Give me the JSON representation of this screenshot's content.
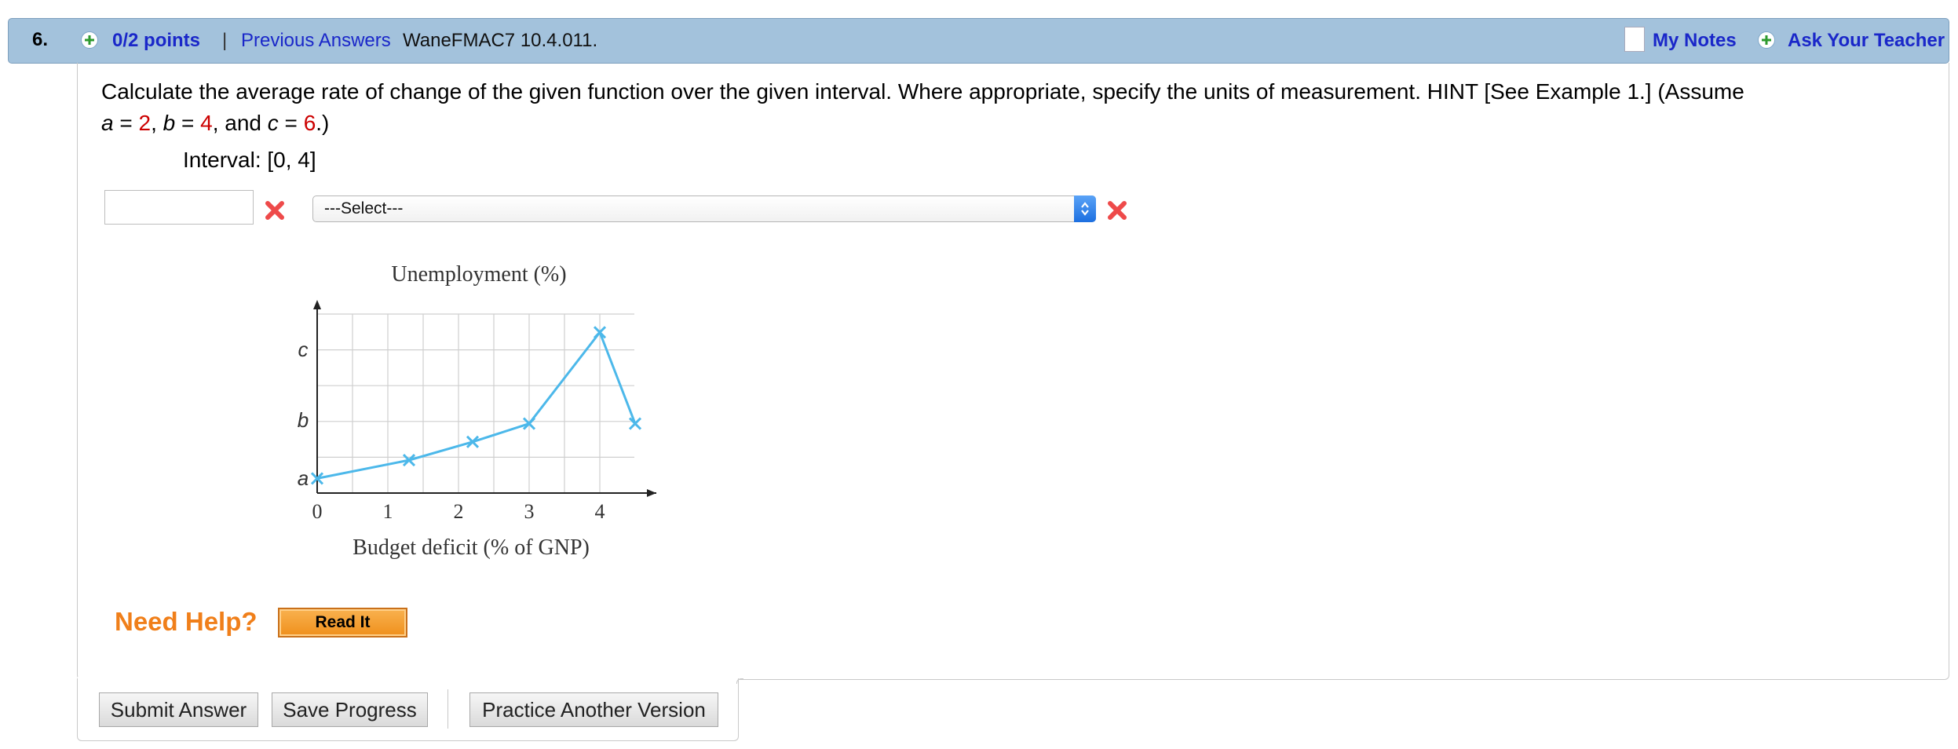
{
  "header": {
    "question_number": "6.",
    "points": "0/2 points",
    "separator": "|",
    "previous_answers": "Previous Answers",
    "problem_code": "WaneFMAC7 10.4.011.",
    "my_notes": "My Notes",
    "ask_teacher": "Ask Your Teacher"
  },
  "question": {
    "text": "Calculate the average rate of change of the given function over the given interval. Where appropriate, specify the units of measurement. HINT [See Example 1.] (Assume",
    "assume": {
      "a_var": "a",
      "eq1": " = ",
      "a_val": "2",
      "comma1": ", ",
      "b_var": "b",
      "eq2": " = ",
      "b_val": "4",
      "comma2": ", and ",
      "c_var": "c",
      "eq3": " = ",
      "c_val": "6",
      "end": ".)"
    },
    "interval": "Interval: [0, 4]"
  },
  "answer": {
    "input_value": "",
    "select_value": "---Select---"
  },
  "chart_data": {
    "type": "line",
    "title": "Unemployment (%)",
    "xlabel": "Budget deficit (% of GNP)",
    "ylabel": "",
    "x_ticks": [
      "0",
      "1",
      "2",
      "3",
      "4"
    ],
    "y_ticks": [
      "a",
      "b",
      "c"
    ],
    "xlim": [
      0,
      4.5
    ],
    "ylim": [
      1.6,
      6.5
    ],
    "grid": true,
    "series": [
      {
        "x": [
          0,
          1.3,
          2.2,
          3,
          4,
          4.5
        ],
        "y": [
          2,
          2.5,
          3,
          3.5,
          6,
          3.5
        ],
        "color": "#4cb8ea"
      }
    ]
  },
  "help": {
    "need_help": "Need Help?",
    "read_it": "Read It"
  },
  "buttons": {
    "submit": "Submit Answer",
    "save": "Save Progress",
    "practice": "Practice Another Version"
  },
  "colors": {
    "header_bg": "#a3c2dc",
    "link": "#1a27c9",
    "accent_red": "#cc0000",
    "help_orange": "#f07f1a"
  }
}
